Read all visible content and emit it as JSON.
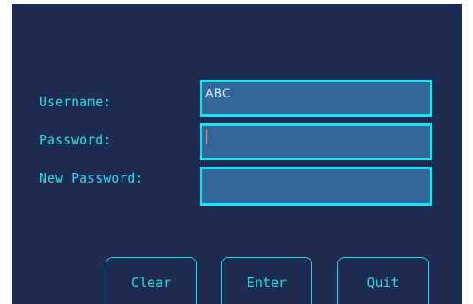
{
  "form": {
    "username_label": "Username:",
    "password_label": "Password:",
    "new_password_label": "New Password:",
    "username_value": "ABC",
    "password_value": "",
    "new_password_value": ""
  },
  "buttons": {
    "clear_label": "Clear",
    "enter_label": "Enter",
    "quit_label": "Quit"
  },
  "colors": {
    "background": "#1c2b4f",
    "text_accent": "#21d6ea",
    "field_fill": "#336699",
    "field_border": "#16e6f2"
  }
}
